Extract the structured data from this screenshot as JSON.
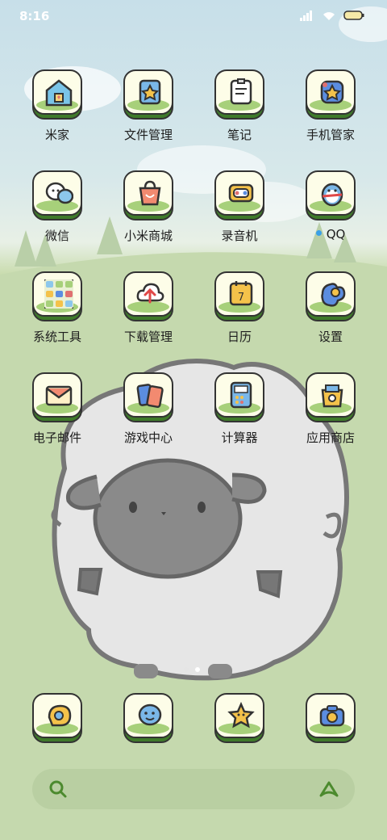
{
  "status_bar": {
    "time": "8:16"
  },
  "apps": [
    {
      "label": "米家",
      "icon": "home-icon"
    },
    {
      "label": "文件管理",
      "icon": "files-icon"
    },
    {
      "label": "笔记",
      "icon": "notes-icon"
    },
    {
      "label": "手机管家",
      "icon": "security-icon"
    },
    {
      "label": "微信",
      "icon": "chat-bubbles-icon"
    },
    {
      "label": "小米商城",
      "icon": "shopping-bag-icon"
    },
    {
      "label": "录音机",
      "icon": "recorder-icon"
    },
    {
      "label": "QQ",
      "icon": "penguin-icon",
      "has_notification_dot": true
    },
    {
      "label": "系统工具",
      "icon": "folder-grid-icon"
    },
    {
      "label": "下载管理",
      "icon": "download-cloud-icon"
    },
    {
      "label": "日历",
      "icon": "calendar-icon",
      "calendar_day": "7"
    },
    {
      "label": "设置",
      "icon": "gear-icon"
    },
    {
      "label": "电子邮件",
      "icon": "envelope-icon"
    },
    {
      "label": "游戏中心",
      "icon": "game-cards-icon"
    },
    {
      "label": "计算器",
      "icon": "calculator-icon"
    },
    {
      "label": "应用商店",
      "icon": "app-store-bag-icon"
    }
  ],
  "dock": [
    {
      "icon": "phone-icon"
    },
    {
      "icon": "message-icon"
    },
    {
      "icon": "browser-star-icon"
    },
    {
      "icon": "camera-icon"
    }
  ],
  "page_indicator": {
    "pages": 2,
    "current": 2
  },
  "search": {
    "left_icon": "search-icon",
    "right_icon": "assistant-icon"
  },
  "colors": {
    "tile_face": "#fdfde8",
    "tile_base": "#3f7a2a",
    "outline": "#333333",
    "grass": "#a7d07a",
    "notification_dot": "#3aa0e8"
  }
}
